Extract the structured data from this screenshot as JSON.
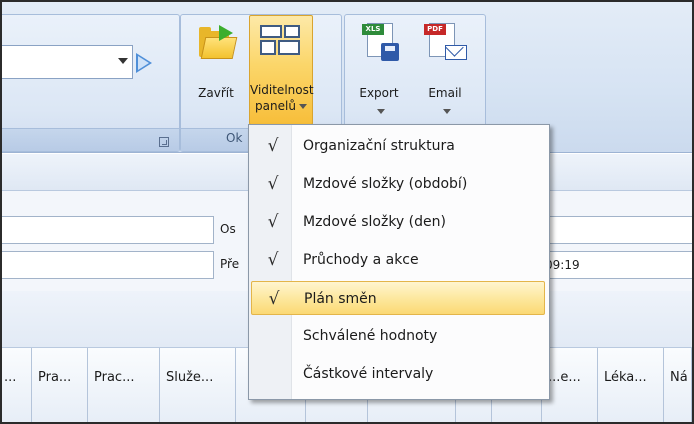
{
  "ribbon": {
    "close_label": "Zavřít",
    "panels_label_line1": "Viditelnost",
    "panels_label_line2": "panelů",
    "group_label": "Ok",
    "export_label": "Export",
    "email_label": "Email",
    "xls_badge": "XLS",
    "pdf_badge": "PDF"
  },
  "form": {
    "label_person": "Os",
    "label_prev": "Pře",
    "time_value": "09:19"
  },
  "grid": {
    "columns": [
      "...",
      "Pra...",
      "Prac...",
      "Služe...",
      "",
      "",
      "",
      "",
      "",
      "...e...",
      "Léka...",
      "Ná"
    ]
  },
  "menu": {
    "items": [
      {
        "label": "Organizační struktura",
        "checked": true
      },
      {
        "label": "Mzdové složky (období)",
        "checked": true
      },
      {
        "label": "Mzdové složky (den)",
        "checked": true
      },
      {
        "label": "Průchody a akce",
        "checked": true
      },
      {
        "label": "Plán směn",
        "checked": true,
        "highlighted": true
      },
      {
        "label": "Schválené hodnoty",
        "checked": false
      },
      {
        "label": "Částkové intervaly",
        "checked": false
      }
    ],
    "check_glyph": "√"
  },
  "colors": {
    "accent": "#fbd66a",
    "ribbon": "#d6e3f3",
    "border": "#a7bddb"
  }
}
